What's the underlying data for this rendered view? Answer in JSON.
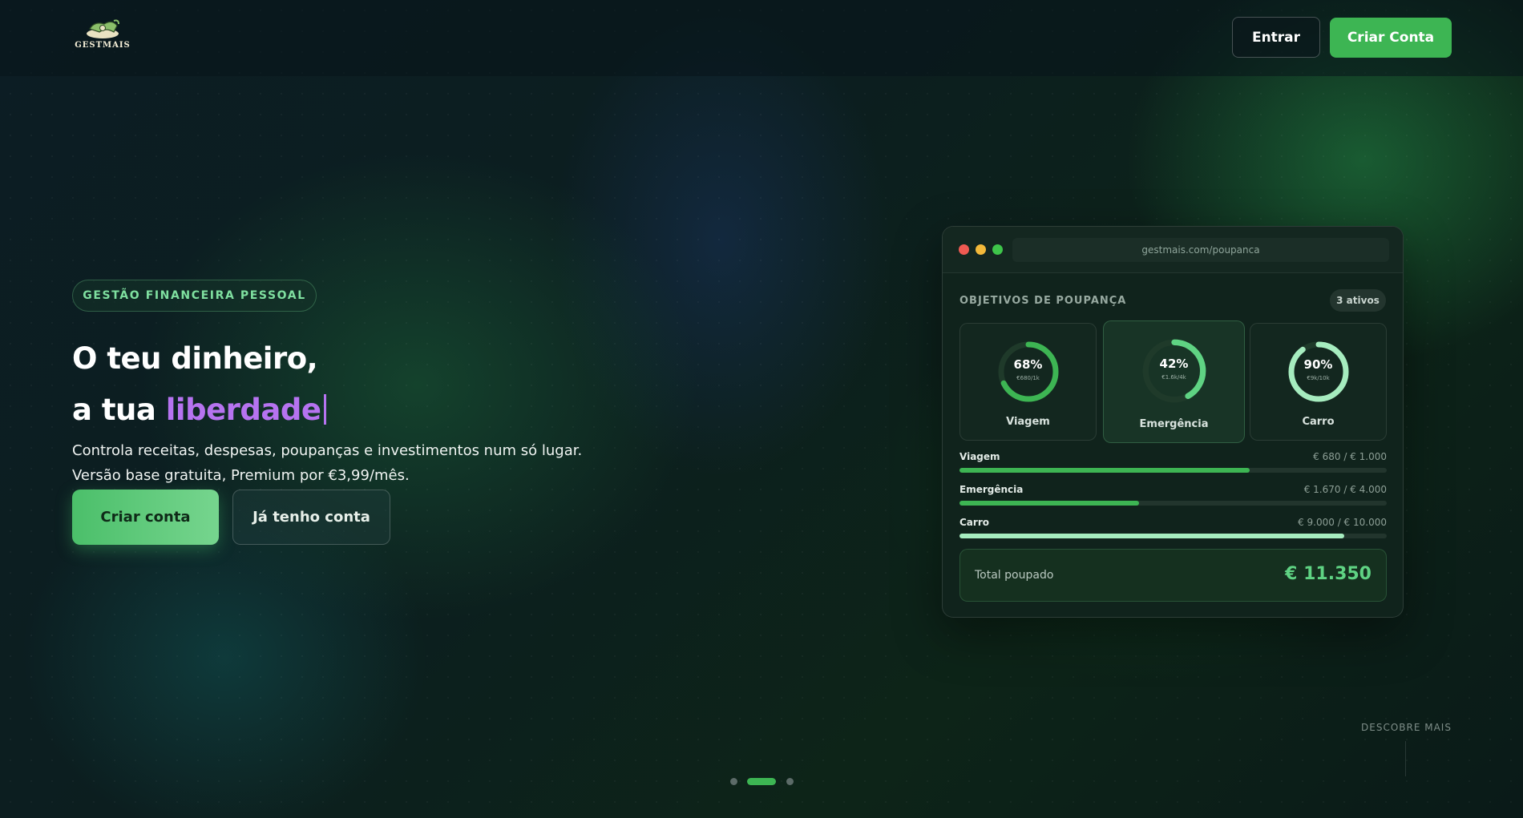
{
  "header": {
    "logo_text": "GESTMAIS",
    "login_label": "Entrar",
    "signup_label": "Criar Conta"
  },
  "hero": {
    "badge": "GESTÃO FINANCEIRA PESSOAL",
    "title_line1": "O teu dinheiro,",
    "title_line2_prefix": "a tua ",
    "title_line2_accent": "liberdade",
    "subtitle_line1": "Controla receitas, despesas, poupanças e investimentos num só lugar.",
    "subtitle_line2": "Versão base gratuita, Premium por €3,99/mês.",
    "cta_primary": "Criar conta",
    "cta_secondary": "Já tenho conta"
  },
  "mockup": {
    "url": "gestmais.com/poupanca",
    "section_title": "OBJETIVOS DE POUPANÇA",
    "active_pill": "3 ativos",
    "goals": [
      {
        "name": "Viagem",
        "percent_label": "68%",
        "percent": 68,
        "small": "€680/1k",
        "color": "#3db553"
      },
      {
        "name": "Emergência",
        "percent_label": "42%",
        "percent": 42,
        "small": "€1.6k/4k",
        "color": "#5fd383"
      },
      {
        "name": "Carro",
        "percent_label": "90%",
        "percent": 90,
        "small": "€9k/10k",
        "color": "#a6ecbf"
      }
    ],
    "progress": [
      {
        "name": "Viagem",
        "value": "€ 680 / € 1.000",
        "percent": 68,
        "color": "#3db553"
      },
      {
        "name": "Emergência",
        "value": "€ 1.670 / € 4.000",
        "percent": 42,
        "color": "#3db553"
      },
      {
        "name": "Carro",
        "value": "€ 9.000 / € 10.000",
        "percent": 90,
        "color": "#a6ecbf"
      }
    ],
    "total_label": "Total poupado",
    "total_value": "€ 11.350"
  },
  "footer": {
    "discover_label": "DESCOBRE MAIS",
    "carousel_active_index": 1
  },
  "colors": {
    "brand_green": "#3db553",
    "accent_purple": "#b673f0"
  }
}
